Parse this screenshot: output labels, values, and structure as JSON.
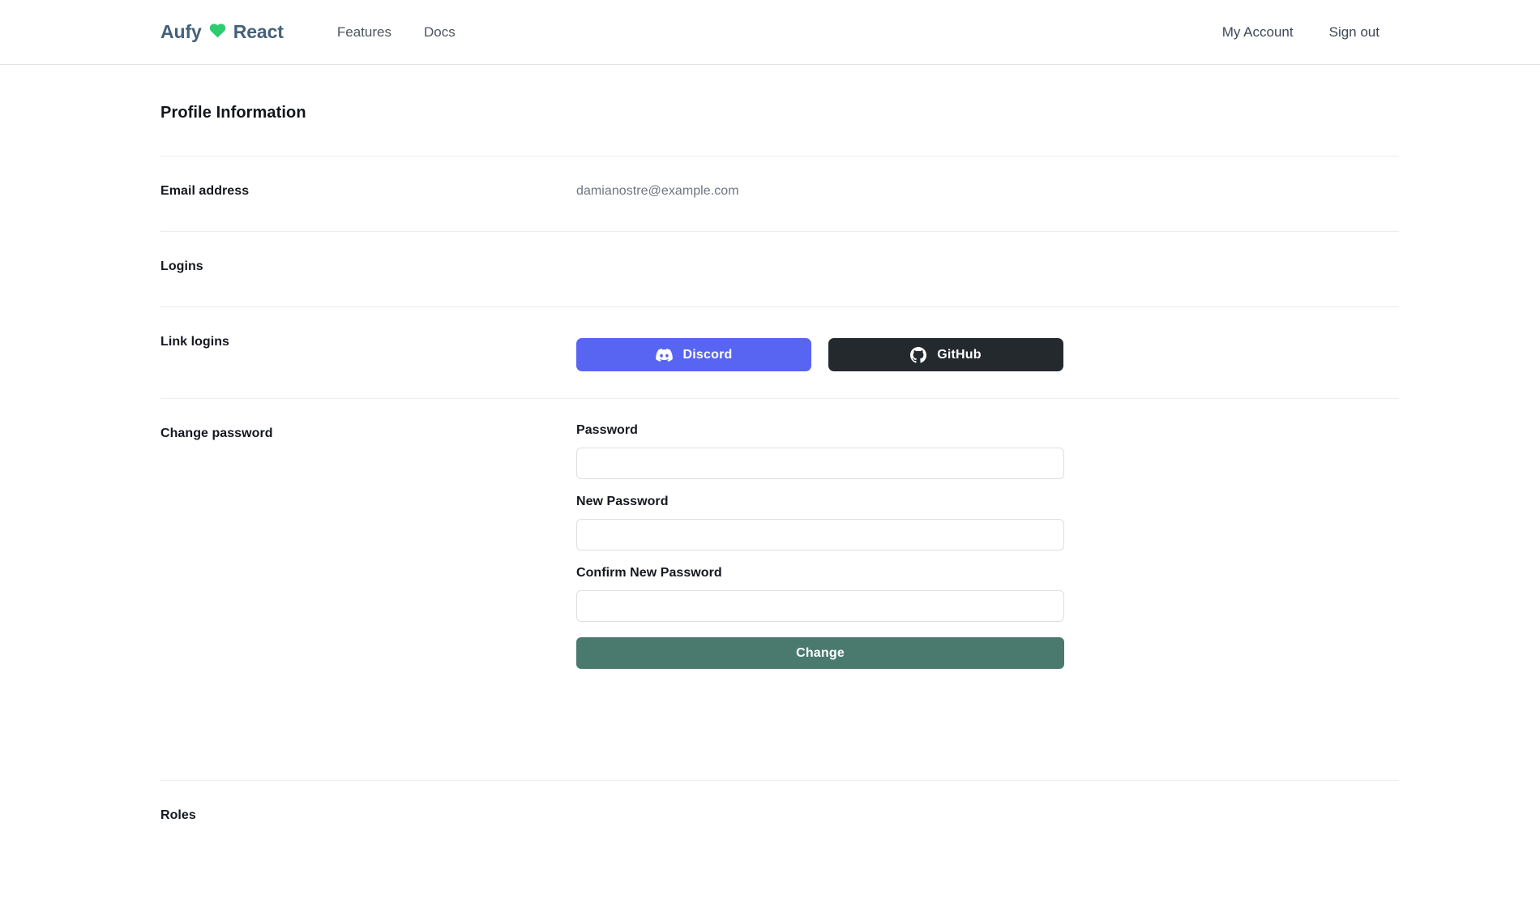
{
  "navbar": {
    "brand": {
      "left_word": "Aufy",
      "heart_icon": "heart-icon",
      "right_word": "React"
    },
    "links": [
      {
        "label": "Features"
      },
      {
        "label": "Docs"
      }
    ],
    "account_links": [
      {
        "label": "My Account"
      },
      {
        "label": "Sign out"
      }
    ]
  },
  "main": {
    "title": "Profile Information",
    "rows": {
      "email": {
        "label": "Email address",
        "value": "damianostre@example.com"
      },
      "logins": {
        "label": "Logins"
      },
      "link_logins": {
        "label": "Link logins",
        "buttons": [
          {
            "label": "Discord",
            "icon": "discord-icon",
            "color": "#5865f2"
          },
          {
            "label": "GitHub",
            "icon": "github-icon",
            "color": "#24292e"
          }
        ]
      },
      "change_password": {
        "label": "Change password",
        "fields": [
          {
            "label": "Password",
            "value": "",
            "placeholder": ""
          },
          {
            "label": "New Password",
            "value": "",
            "placeholder": ""
          },
          {
            "label": "Confirm New Password",
            "value": "",
            "placeholder": ""
          }
        ],
        "submit_label": "Change",
        "submit_color": "#4a7a6e"
      },
      "roles": {
        "label": "Roles"
      }
    }
  }
}
